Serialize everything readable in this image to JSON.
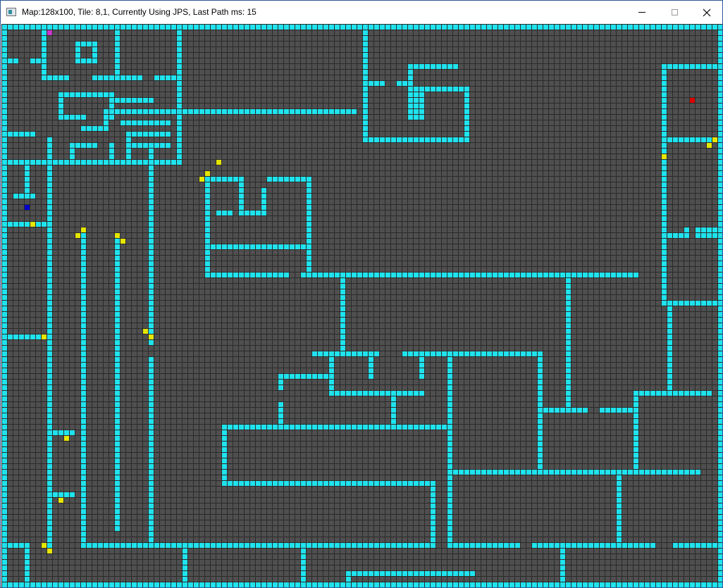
{
  "window": {
    "title": "Map:128x100, Tile: 8,1, Currently Using JPS, Last Path ms: 15",
    "controls": {
      "minimize": "minimize-icon",
      "maximize": "maximize-icon",
      "close": "close-icon"
    }
  },
  "colors": {
    "floor": "#4f4f4f",
    "grid": "#2a2a2a",
    "wall": "#1fe3ee",
    "start": "#cc33cc",
    "goal": "#e00000",
    "agent": "#0000cc",
    "jump_point": "#e6e600"
  },
  "map": {
    "cols": 128,
    "rows": 100,
    "walls": [
      [
        0,
        0,
        127,
        0
      ],
      [
        0,
        99,
        127,
        99
      ],
      [
        0,
        0,
        0,
        99
      ],
      [
        127,
        0,
        127,
        99
      ],
      [
        1,
        6,
        2,
        6
      ],
      [
        5,
        6,
        6,
        6
      ],
      [
        7,
        1,
        7,
        9
      ],
      [
        7,
        9,
        11,
        9
      ],
      [
        13,
        3,
        15,
        3
      ],
      [
        13,
        3,
        13,
        6
      ],
      [
        13,
        6,
        15,
        6
      ],
      [
        16,
        3,
        16,
        6
      ],
      [
        20,
        1,
        20,
        9
      ],
      [
        16,
        9,
        24,
        9
      ],
      [
        27,
        9,
        30,
        9
      ],
      [
        31,
        1,
        31,
        24
      ],
      [
        10,
        12,
        19,
        12
      ],
      [
        10,
        12,
        10,
        16
      ],
      [
        10,
        16,
        14,
        16
      ],
      [
        19,
        12,
        19,
        16
      ],
      [
        20,
        13,
        26,
        13
      ],
      [
        18,
        15,
        30,
        15
      ],
      [
        20,
        15,
        62,
        15
      ],
      [
        14,
        18,
        18,
        18
      ],
      [
        18,
        16,
        18,
        18
      ],
      [
        21,
        17,
        29,
        17
      ],
      [
        22,
        19,
        29,
        19
      ],
      [
        1,
        19,
        5,
        19
      ],
      [
        8,
        20,
        8,
        24
      ],
      [
        12,
        21,
        16,
        21
      ],
      [
        12,
        21,
        12,
        24
      ],
      [
        19,
        21,
        19,
        24
      ],
      [
        22,
        19,
        22,
        24
      ],
      [
        23,
        21,
        29,
        21
      ],
      [
        26,
        21,
        26,
        24
      ],
      [
        0,
        24,
        31,
        24
      ],
      [
        4,
        24,
        4,
        30
      ],
      [
        2,
        30,
        5,
        30
      ],
      [
        1,
        35,
        7,
        35
      ],
      [
        8,
        24,
        8,
        92
      ],
      [
        14,
        36,
        14,
        92
      ],
      [
        20,
        37,
        20,
        89
      ],
      [
        26,
        24,
        26,
        56
      ],
      [
        26,
        59,
        26,
        92
      ],
      [
        14,
        92,
        76,
        92
      ],
      [
        64,
        1,
        64,
        20
      ],
      [
        64,
        20,
        81,
        20
      ],
      [
        82,
        12,
        82,
        20
      ],
      [
        64,
        10,
        67,
        10
      ],
      [
        70,
        10,
        72,
        10
      ],
      [
        72,
        7,
        72,
        16
      ],
      [
        72,
        7,
        80,
        7
      ],
      [
        72,
        11,
        82,
        11
      ],
      [
        73,
        11,
        73,
        16
      ],
      [
        74,
        11,
        74,
        16
      ],
      [
        36,
        27,
        36,
        44
      ],
      [
        36,
        27,
        42,
        27
      ],
      [
        42,
        27,
        42,
        33
      ],
      [
        42,
        33,
        46,
        33
      ],
      [
        46,
        29,
        46,
        33
      ],
      [
        47,
        27,
        54,
        27
      ],
      [
        54,
        27,
        54,
        44
      ],
      [
        36,
        39,
        54,
        39
      ],
      [
        36,
        44,
        50,
        44
      ],
      [
        38,
        33,
        40,
        33
      ],
      [
        53,
        44,
        112,
        44
      ],
      [
        60,
        44,
        60,
        58
      ],
      [
        100,
        44,
        100,
        68
      ],
      [
        55,
        58,
        66,
        58
      ],
      [
        65,
        58,
        65,
        62
      ],
      [
        71,
        58,
        95,
        58
      ],
      [
        74,
        58,
        74,
        62
      ],
      [
        58,
        59,
        58,
        65
      ],
      [
        49,
        62,
        57,
        62
      ],
      [
        49,
        62,
        49,
        64
      ],
      [
        58,
        65,
        74,
        65
      ],
      [
        69,
        65,
        69,
        71
      ],
      [
        79,
        58,
        79,
        92
      ],
      [
        95,
        58,
        95,
        79
      ],
      [
        49,
        67,
        49,
        71
      ],
      [
        39,
        71,
        79,
        71
      ],
      [
        39,
        71,
        39,
        81
      ],
      [
        39,
        81,
        76,
        81
      ],
      [
        76,
        81,
        76,
        92
      ],
      [
        79,
        79,
        123,
        79
      ],
      [
        95,
        68,
        103,
        68
      ],
      [
        106,
        68,
        112,
        68
      ],
      [
        112,
        65,
        125,
        65
      ],
      [
        112,
        65,
        112,
        79
      ],
      [
        118,
        54,
        118,
        65
      ],
      [
        109,
        92,
        115,
        92
      ],
      [
        79,
        92,
        91,
        92
      ],
      [
        94,
        92,
        109,
        92
      ],
      [
        99,
        92,
        99,
        99
      ],
      [
        32,
        92,
        32,
        99
      ],
      [
        53,
        92,
        53,
        99
      ],
      [
        61,
        97,
        83,
        97
      ],
      [
        61,
        97,
        61,
        99
      ],
      [
        4,
        92,
        4,
        99
      ],
      [
        109,
        79,
        109,
        92
      ],
      [
        117,
        7,
        127,
        7
      ],
      [
        117,
        7,
        117,
        49
      ],
      [
        117,
        20,
        127,
        20
      ],
      [
        117,
        37,
        121,
        37
      ],
      [
        121,
        36,
        121,
        37
      ],
      [
        123,
        36,
        127,
        37
      ],
      [
        118,
        49,
        118,
        58
      ],
      [
        117,
        49,
        127,
        49
      ],
      [
        119,
        92,
        127,
        92
      ],
      [
        1,
        92,
        4,
        92
      ],
      [
        1,
        55,
        7,
        55
      ],
      [
        9,
        72,
        12,
        72
      ],
      [
        9,
        83,
        12,
        83
      ],
      [
        8,
        92,
        8,
        93
      ]
    ],
    "cells": [
      {
        "col": 8,
        "row": 1,
        "type": "start"
      },
      {
        "col": 122,
        "row": 13,
        "type": "goal"
      },
      {
        "col": 4,
        "row": 32,
        "type": "agent"
      },
      {
        "col": 38,
        "row": 24,
        "type": "jump_point"
      },
      {
        "col": 36,
        "row": 26,
        "type": "jump_point"
      },
      {
        "col": 35,
        "row": 27,
        "type": "jump_point"
      },
      {
        "col": 5,
        "row": 35,
        "type": "jump_point"
      },
      {
        "col": 14,
        "row": 36,
        "type": "jump_point"
      },
      {
        "col": 13,
        "row": 37,
        "type": "jump_point"
      },
      {
        "col": 20,
        "row": 37,
        "type": "jump_point"
      },
      {
        "col": 21,
        "row": 38,
        "type": "jump_point"
      },
      {
        "col": 25,
        "row": 54,
        "type": "jump_point"
      },
      {
        "col": 26,
        "row": 55,
        "type": "jump_point"
      },
      {
        "col": 7,
        "row": 55,
        "type": "jump_point"
      },
      {
        "col": 11,
        "row": 73,
        "type": "jump_point"
      },
      {
        "col": 10,
        "row": 84,
        "type": "jump_point"
      },
      {
        "col": 7,
        "row": 92,
        "type": "jump_point"
      },
      {
        "col": 8,
        "row": 93,
        "type": "jump_point"
      },
      {
        "col": 117,
        "row": 23,
        "type": "jump_point"
      },
      {
        "col": 125,
        "row": 21,
        "type": "jump_point"
      },
      {
        "col": 126,
        "row": 20,
        "type": "jump_point"
      }
    ]
  }
}
